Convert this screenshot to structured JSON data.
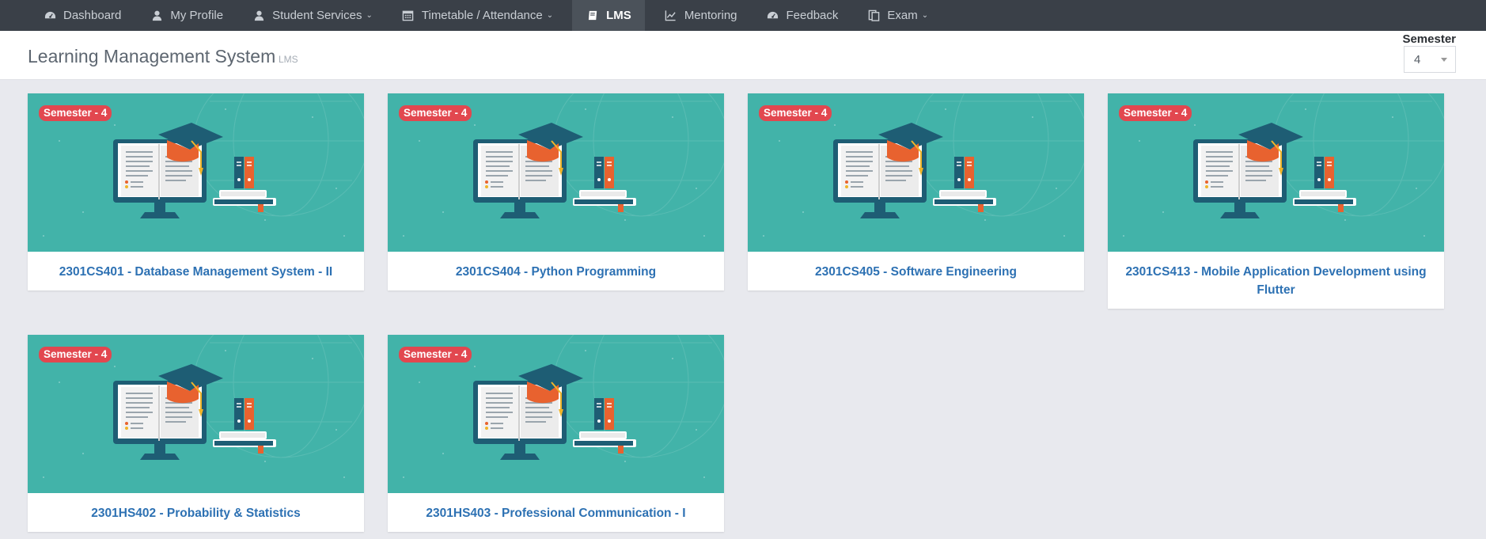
{
  "nav": {
    "items": [
      {
        "label": "Dashboard",
        "icon": "dashboard-icon",
        "caret": false,
        "active": false
      },
      {
        "label": "My Profile",
        "icon": "user-icon",
        "caret": false,
        "active": false
      },
      {
        "label": "Student Services",
        "icon": "user-icon",
        "caret": true,
        "active": false
      },
      {
        "label": "Timetable / Attendance",
        "icon": "calendar-icon",
        "caret": true,
        "active": false
      },
      {
        "label": "LMS",
        "icon": "book-icon",
        "caret": false,
        "active": true
      },
      {
        "label": "Mentoring",
        "icon": "line-chart-icon",
        "caret": false,
        "active": false
      },
      {
        "label": "Feedback",
        "icon": "dashboard-icon",
        "caret": false,
        "active": false
      },
      {
        "label": "Exam",
        "icon": "files-icon",
        "caret": true,
        "active": false
      }
    ]
  },
  "header": {
    "title": "Learning Management System",
    "subtitle": "LMS",
    "semester_label": "Semester",
    "semester_value": "4"
  },
  "courses": [
    {
      "badge": "Semester - 4",
      "title": "2301CS401 - Database Management System - II"
    },
    {
      "badge": "Semester - 4",
      "title": "2301CS404 - Python Programming"
    },
    {
      "badge": "Semester - 4",
      "title": "2301CS405 - Software Engineering"
    },
    {
      "badge": "Semester - 4",
      "title": "2301CS413 - Mobile Application Development using Flutter"
    },
    {
      "badge": "Semester - 4",
      "title": "2301HS402 - Probability & Statistics"
    },
    {
      "badge": "Semester - 4",
      "title": "2301HS403 - Professional Communication - I"
    }
  ],
  "colors": {
    "nav_bg": "#3a4048",
    "card_image_bg": "#42b3a9",
    "badge_bg": "#e2474f",
    "link": "#2d71b3"
  }
}
